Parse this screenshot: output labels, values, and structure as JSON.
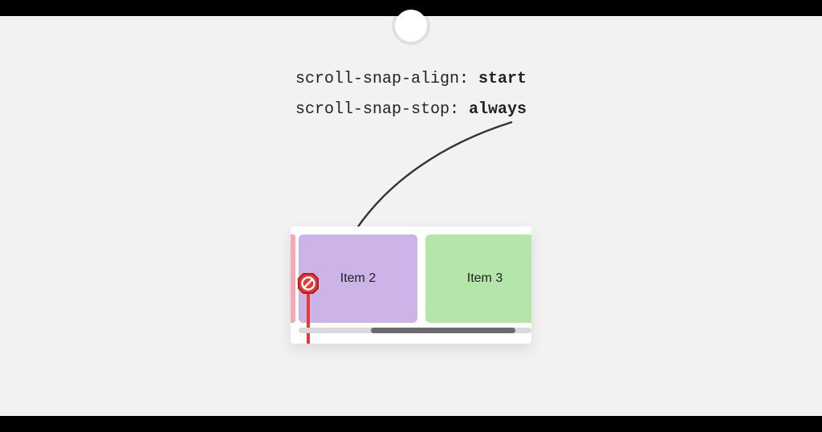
{
  "code": {
    "line1_prop": "scroll-snap-align: ",
    "line1_val": "start",
    "line2_prop": "scroll-snap-stop: ",
    "line2_val": "always"
  },
  "items": {
    "item2": "Item 2",
    "item3": "Item 3"
  },
  "colors": {
    "item2_bg": "#ccb3e8",
    "item3_bg": "#b3e6a8",
    "stop_sign": "#e53935"
  }
}
